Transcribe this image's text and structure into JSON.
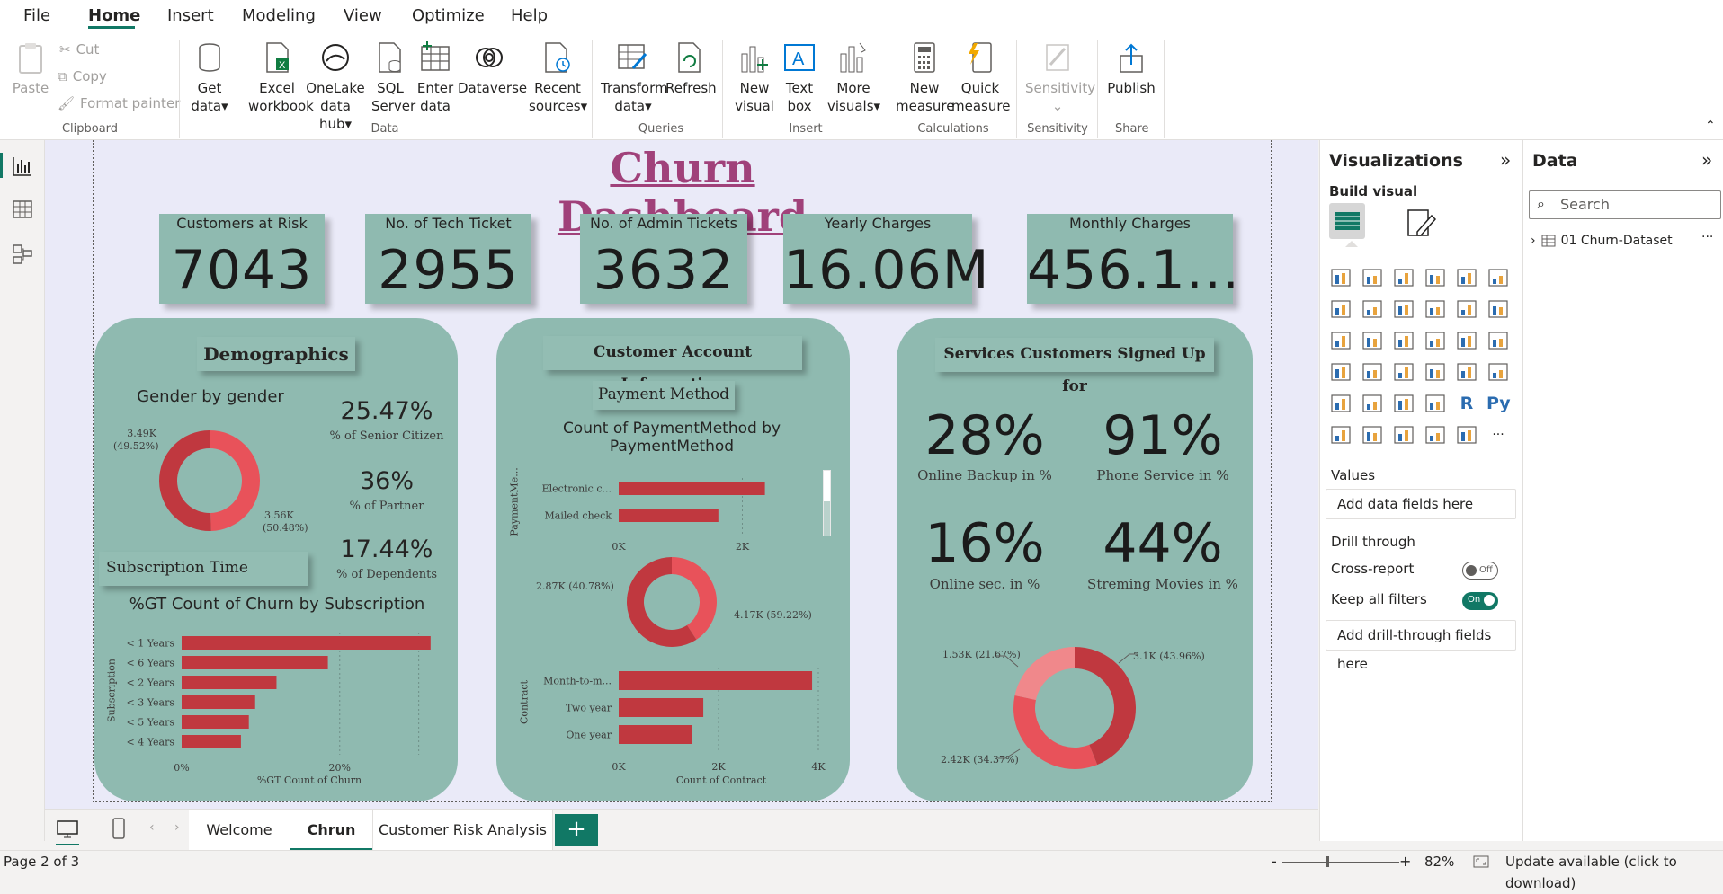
{
  "menu": {
    "tabs": [
      "File",
      "Home",
      "Insert",
      "Modeling",
      "View",
      "Optimize",
      "Help"
    ],
    "active": "Home"
  },
  "ribbon": {
    "clipboard": {
      "paste": "Paste",
      "cut": "Cut",
      "copy": "Copy",
      "format_painter": "Format painter",
      "group": "Clipboard"
    },
    "data": {
      "get_data_1": "Get",
      "get_data_2": "data",
      "excel_1": "Excel",
      "excel_2": "workbook",
      "onelake_1": "OneLake",
      "onelake_2": "data hub",
      "sql_1": "SQL",
      "sql_2": "Server",
      "enter_1": "Enter",
      "enter_2": "data",
      "dataverse": "Dataverse",
      "recent_1": "Recent",
      "recent_2": "sources",
      "group": "Data"
    },
    "queries": {
      "transform_1": "Transform",
      "transform_2": "data",
      "refresh": "Refresh",
      "group": "Queries"
    },
    "insert": {
      "newvis_1": "New",
      "newvis_2": "visual",
      "textbox_1": "Text",
      "textbox_2": "box",
      "more_1": "More",
      "more_2": "visuals",
      "group": "Insert"
    },
    "calculations": {
      "newmeasure_1": "New",
      "newmeasure_2": "measure",
      "quick_1": "Quick",
      "quick_2": "measure",
      "group": "Calculations"
    },
    "sensitivity": {
      "label": "Sensitivity",
      "group": "Sensitivity"
    },
    "share": {
      "publish": "Publish",
      "group": "Share"
    }
  },
  "report": {
    "title": "Churn Dashboard",
    "kpis": [
      {
        "label": "Customers at Risk",
        "value": "7043"
      },
      {
        "label": "No. of Tech Ticket",
        "value": "2955"
      },
      {
        "label": "No. of Admin Tickets",
        "value": "3632"
      },
      {
        "label": "Yearly Charges",
        "value": "16.06M"
      },
      {
        "label": "Monthly Charges",
        "value": "456.1..."
      }
    ],
    "demographics": {
      "header": "Demographics",
      "gender_title": "Gender by gender",
      "donut_left": "3.49K",
      "donut_left_pct": "(49.52%)",
      "donut_right": "3.56K",
      "donut_right_pct": "(50.48%)",
      "stat1_val": "25.47%",
      "stat1_lbl": "% of Senior Citizen",
      "stat2_val": "36%",
      "stat2_lbl": "% of  Partner",
      "stat3_val": "17.44%",
      "stat3_lbl": "% of  Dependents",
      "subscription_header": "Subscription Time",
      "subscription_title": "%GT Count of Churn by Subscription",
      "y_axis": "Subscription",
      "x_axis": "%GT Count of Churn",
      "x_ticks": [
        "0%",
        "20%"
      ]
    },
    "account": {
      "header": "Customer Account Information",
      "payment_header": "Payment Method",
      "payment_title_1": "Count of PaymentMethod by",
      "payment_title_2": "PaymentMethod",
      "payment_y_axis": "PaymentMe...",
      "payment_x_ticks": [
        "0K",
        "2K"
      ],
      "donut_left": "2.87K (40.78%)",
      "donut_right": "4.17K (59.22%)",
      "contract_y_axis": "Contract",
      "contract_x_axis": "Count of Contract",
      "contract_x_ticks": [
        "0K",
        "2K",
        "4K"
      ]
    },
    "services": {
      "header": "Services Customers Signed Up for",
      "s1_val": "28%",
      "s1_lbl": "Online Backup in %",
      "s2_val": "91%",
      "s2_lbl": "Phone Service in %",
      "s3_val": "16%",
      "s3_lbl": "Online sec. in %",
      "s4_val": "44%",
      "s4_lbl": "Streming Movies in %",
      "donut_top_left": "1.53K (21.67%)",
      "donut_top_right": "3.1K (43.96%)",
      "donut_bottom_left": "2.42K (34.37%)"
    }
  },
  "chart_data": [
    {
      "type": "pie",
      "title": "Gender by gender",
      "values": [
        3.49,
        3.56
      ],
      "labels": [
        "3.49K (49.52%)",
        "3.56K (50.48%)"
      ],
      "unit": "K",
      "colors": [
        "#e8525a",
        "#c0383f"
      ]
    },
    {
      "type": "bar",
      "title": "%GT Count of Churn by Subscription",
      "categories": [
        "< 1 Years",
        "< 6 Years",
        "< 2 Years",
        "< 3 Years",
        "< 5 Years",
        "< 4 Years"
      ],
      "values": [
        31.5,
        18.5,
        12,
        9.3,
        8.5,
        7.5
      ],
      "xlabel": "%GT Count of Churn",
      "ylabel": "Subscription",
      "xlim": [
        0,
        33
      ]
    },
    {
      "type": "bar",
      "title": "Count of PaymentMethod by PaymentMethod",
      "categories": [
        "Electronic c...",
        "Mailed check"
      ],
      "values": [
        2365,
        1612
      ],
      "ylabel": "PaymentMe...",
      "xlim": [
        0,
        3200
      ]
    },
    {
      "type": "pie",
      "values": [
        2.87,
        4.17
      ],
      "labels": [
        "2.87K (40.78%)",
        "4.17K (59.22%)"
      ],
      "unit": "K",
      "colors": [
        "#e8525a",
        "#c0383f"
      ]
    },
    {
      "type": "bar",
      "categories": [
        "Month-to-m...",
        "Two year",
        "One year"
      ],
      "values": [
        3875,
        1695,
        1473
      ],
      "xlabel": "Count of Contract",
      "ylabel": "Contract",
      "xlim": [
        0,
        4000
      ]
    },
    {
      "type": "pie",
      "values": [
        3.1,
        2.42,
        1.53
      ],
      "labels": [
        "3.1K (43.96%)",
        "2.42K (34.37%)",
        "1.53K (21.67%)"
      ],
      "unit": "K",
      "colors": [
        "#c0383f",
        "#e8525a",
        "#f0888b"
      ]
    }
  ],
  "viz_pane": {
    "title": "Visualizations",
    "build": "Build visual",
    "values": "Values",
    "values_placeholder": "Add data fields here",
    "drill": "Drill through",
    "cross": "Cross-report",
    "cross_state": "Off",
    "keep": "Keep all filters",
    "keep_state": "On",
    "drill_placeholder": "Add drill-through fields here"
  },
  "data_pane": {
    "title": "Data",
    "search_placeholder": "Search",
    "table": "01 Churn-Dataset"
  },
  "page_tabs": {
    "tabs": [
      "Welcome",
      "Chrun",
      "Customer Risk Analysis"
    ],
    "active": "Chrun"
  },
  "status": {
    "page": "Page 2 of 3",
    "zoom": "82%",
    "update": "Update available (click to download)"
  },
  "colors": {
    "accent": "#117865",
    "card": "#8fbab0",
    "bar": "#c0383f",
    "title": "#a0417a"
  }
}
